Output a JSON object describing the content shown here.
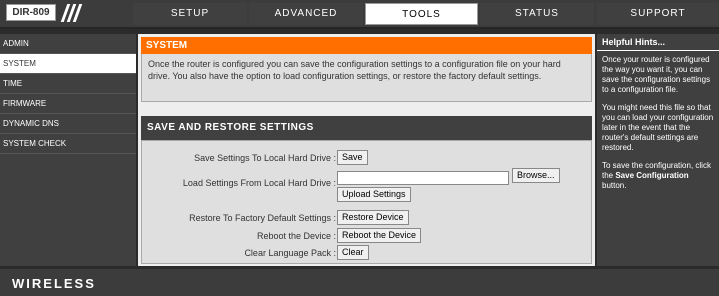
{
  "header": {
    "model": "DIR-809",
    "tabs": [
      "SETUP",
      "ADVANCED",
      "TOOLS",
      "STATUS",
      "SUPPORT"
    ],
    "active_tab": "TOOLS"
  },
  "sidebar": {
    "items": [
      "ADMIN",
      "SYSTEM",
      "TIME",
      "FIRMWARE",
      "DYNAMIC DNS",
      "SYSTEM CHECK"
    ],
    "active": "SYSTEM"
  },
  "system_panel": {
    "title": "SYSTEM",
    "description": "Once the router is configured you can save the configuration settings to a configuration file on your hard drive. You also have the option to load configuration settings, or restore the factory default settings."
  },
  "save_restore": {
    "title": "SAVE AND RESTORE SETTINGS",
    "save_label": "Save Settings To Local Hard Drive :",
    "save_button": "Save",
    "load_label": "Load Settings From Local Hard Drive :",
    "file_value": "",
    "browse_button": "Browse...",
    "upload_button": "Upload Settings",
    "restore_label": "Restore To Factory Default Settings :",
    "restore_button": "Restore Device",
    "reboot_label": "Reboot the Device :",
    "reboot_button": "Reboot the Device",
    "clear_label": "Clear Language Pack :",
    "clear_button": "Clear"
  },
  "hints": {
    "title": "Helpful Hints...",
    "p1": "Once your router is configured the way you want it, you can save the configuration settings to a configuration file.",
    "p2": "You might need this file so that you can load your configuration later in the event that the router's default settings are restored.",
    "p3_a": "To save the configuration, click the ",
    "p3_b": "Save Configuration",
    "p3_c": " button."
  },
  "footer": {
    "brand": "WIRELESS"
  }
}
